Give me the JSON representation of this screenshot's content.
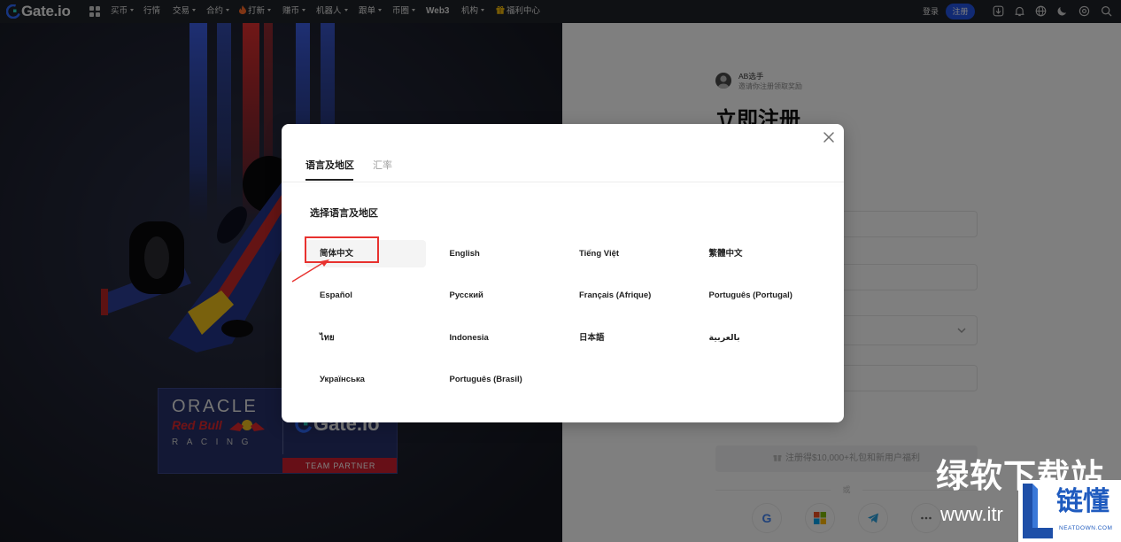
{
  "nav": {
    "logo_text": "Gate.io",
    "menu": [
      {
        "label": "买币",
        "dropdown": true
      },
      {
        "label": "行情",
        "dropdown": false
      },
      {
        "label": "交易",
        "dropdown": true
      },
      {
        "label": "合约",
        "dropdown": true
      },
      {
        "label": "打新",
        "dropdown": true,
        "icon": "fire-icon"
      },
      {
        "label": "赚币",
        "dropdown": true
      },
      {
        "label": "机器人",
        "dropdown": true
      },
      {
        "label": "跟单",
        "dropdown": true
      },
      {
        "label": "币圈",
        "dropdown": true
      },
      {
        "label": "Web3",
        "dropdown": false
      },
      {
        "label": "机构",
        "dropdown": true
      },
      {
        "label": "福利中心",
        "dropdown": false,
        "icon": "gift-icon"
      }
    ],
    "login_label": "登录",
    "register_label": "注册",
    "tool_icons": [
      "download-icon",
      "bell-icon",
      "globe-icon",
      "moon-icon",
      "settings-icon",
      "search-icon"
    ]
  },
  "hero": {
    "banner": {
      "oracle": "ORACLE",
      "red_bull": "Red Bull",
      "racing": "RACING",
      "partner": "Gate.io",
      "tag": "TEAM PARTNER"
    }
  },
  "register_form": {
    "inviter_name": "AB选手",
    "invite_text": "邀请你注册领取奖励",
    "title": "立即注册",
    "submit_label": "注册得$10,000+礼包和新用户福利",
    "or_label": "或",
    "social": {
      "google_glyph": "G",
      "icons": [
        "google-icon",
        "windows-icon",
        "telegram-icon",
        "more-icon"
      ]
    }
  },
  "modal": {
    "tabs": [
      {
        "label": "语言及地区",
        "active": true
      },
      {
        "label": "汇率",
        "active": false
      }
    ],
    "section_title": "选择语言及地区",
    "languages": [
      {
        "label": "简体中文",
        "selected": true
      },
      {
        "label": "English",
        "selected": false
      },
      {
        "label": "Tiếng Việt",
        "selected": false
      },
      {
        "label": "繁體中文",
        "selected": false
      },
      {
        "label": "Español",
        "selected": false
      },
      {
        "label": "Русский",
        "selected": false
      },
      {
        "label": "Français (Afrique)",
        "selected": false
      },
      {
        "label": "Português (Portugal)",
        "selected": false
      },
      {
        "label": "ไทย",
        "selected": false
      },
      {
        "label": "Indonesia",
        "selected": false
      },
      {
        "label": "日本語",
        "selected": false
      },
      {
        "label": "بالعربية",
        "selected": false
      },
      {
        "label": "Українська",
        "selected": false
      },
      {
        "label": "Português (Brasil)",
        "selected": false
      }
    ],
    "close_icon": "close-icon"
  },
  "watermark": {
    "site_name": "绿软下载站",
    "url_fragment": "www.itr",
    "brand": "链懂",
    "brand_domain": "NEATDOWN.COM"
  },
  "colors": {
    "accent": "#2354e6",
    "annotation": "#e8322f",
    "backdrop": "rgba(0, 0, 0, 0.5)",
    "selected_bg": "#f4f4f4",
    "red_bull_red": "#e0262c",
    "team_partner_red": "#cf1f2e",
    "watermark_blue": "#1f5bbf"
  }
}
